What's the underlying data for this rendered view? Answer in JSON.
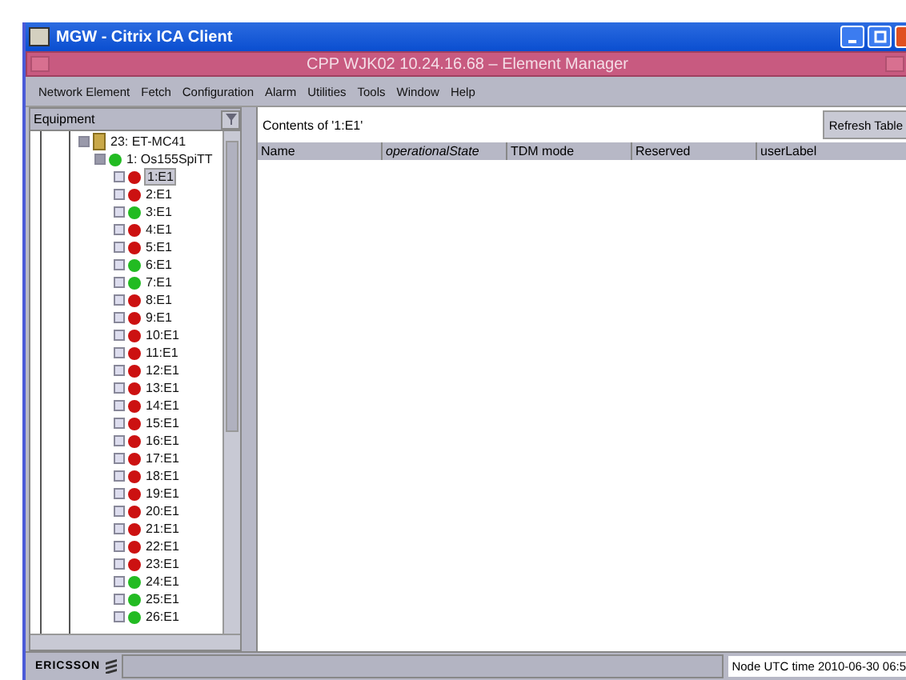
{
  "window": {
    "title": "MGW - Citrix ICA Client"
  },
  "app_bar": {
    "title": "CPP WJK02 10.24.16.68 – Element Manager"
  },
  "menu": [
    "Network Element",
    "Fetch",
    "Configuration",
    "Alarm",
    "Utilities",
    "Tools",
    "Window",
    "Help"
  ],
  "sidebar": {
    "title": "Equipment",
    "tree": [
      {
        "label": "23: ET-MC41",
        "expanded": true,
        "selected": false,
        "children": [
          {
            "label": "1: Os155SpiTT",
            "color": "#22bb22",
            "expanded": true,
            "selected": false,
            "children": [
              {
                "label": "1:E1",
                "color": "#cc1111",
                "selected": true
              },
              {
                "label": "2:E1",
                "color": "#cc1111",
                "selected": false
              },
              {
                "label": "3:E1",
                "color": "#22bb22",
                "selected": false
              },
              {
                "label": "4:E1",
                "color": "#cc1111",
                "selected": false
              },
              {
                "label": "5:E1",
                "color": "#cc1111",
                "selected": false
              },
              {
                "label": "6:E1",
                "color": "#22bb22",
                "selected": false
              },
              {
                "label": "7:E1",
                "color": "#22bb22",
                "selected": false
              },
              {
                "label": "8:E1",
                "color": "#cc1111",
                "selected": false
              },
              {
                "label": "9:E1",
                "color": "#cc1111",
                "selected": false
              },
              {
                "label": "10:E1",
                "color": "#cc1111",
                "selected": false
              },
              {
                "label": "11:E1",
                "color": "#cc1111",
                "selected": false
              },
              {
                "label": "12:E1",
                "color": "#cc1111",
                "selected": false
              },
              {
                "label": "13:E1",
                "color": "#cc1111",
                "selected": false
              },
              {
                "label": "14:E1",
                "color": "#cc1111",
                "selected": false
              },
              {
                "label": "15:E1",
                "color": "#cc1111",
                "selected": false
              },
              {
                "label": "16:E1",
                "color": "#cc1111",
                "selected": false
              },
              {
                "label": "17:E1",
                "color": "#cc1111",
                "selected": false
              },
              {
                "label": "18:E1",
                "color": "#cc1111",
                "selected": false
              },
              {
                "label": "19:E1",
                "color": "#cc1111",
                "selected": false
              },
              {
                "label": "20:E1",
                "color": "#cc1111",
                "selected": false
              },
              {
                "label": "21:E1",
                "color": "#cc1111",
                "selected": false
              },
              {
                "label": "22:E1",
                "color": "#cc1111",
                "selected": false
              },
              {
                "label": "23:E1",
                "color": "#cc1111",
                "selected": false
              },
              {
                "label": "24:E1",
                "color": "#22bb22",
                "selected": false
              },
              {
                "label": "25:E1",
                "color": "#22bb22",
                "selected": false
              },
              {
                "label": "26:E1",
                "color": "#22bb22",
                "selected": false
              }
            ]
          }
        ]
      }
    ]
  },
  "content": {
    "title": "Contents of '1:E1'",
    "refresh_button": "Refresh Table",
    "table": {
      "columns": [
        "Name",
        "operationalState",
        "TDM mode",
        "Reserved",
        "userLabel"
      ]
    }
  },
  "status_bar": {
    "logo": "ERICSSON",
    "time": "Node UTC time 2010-06-30 06:5"
  }
}
